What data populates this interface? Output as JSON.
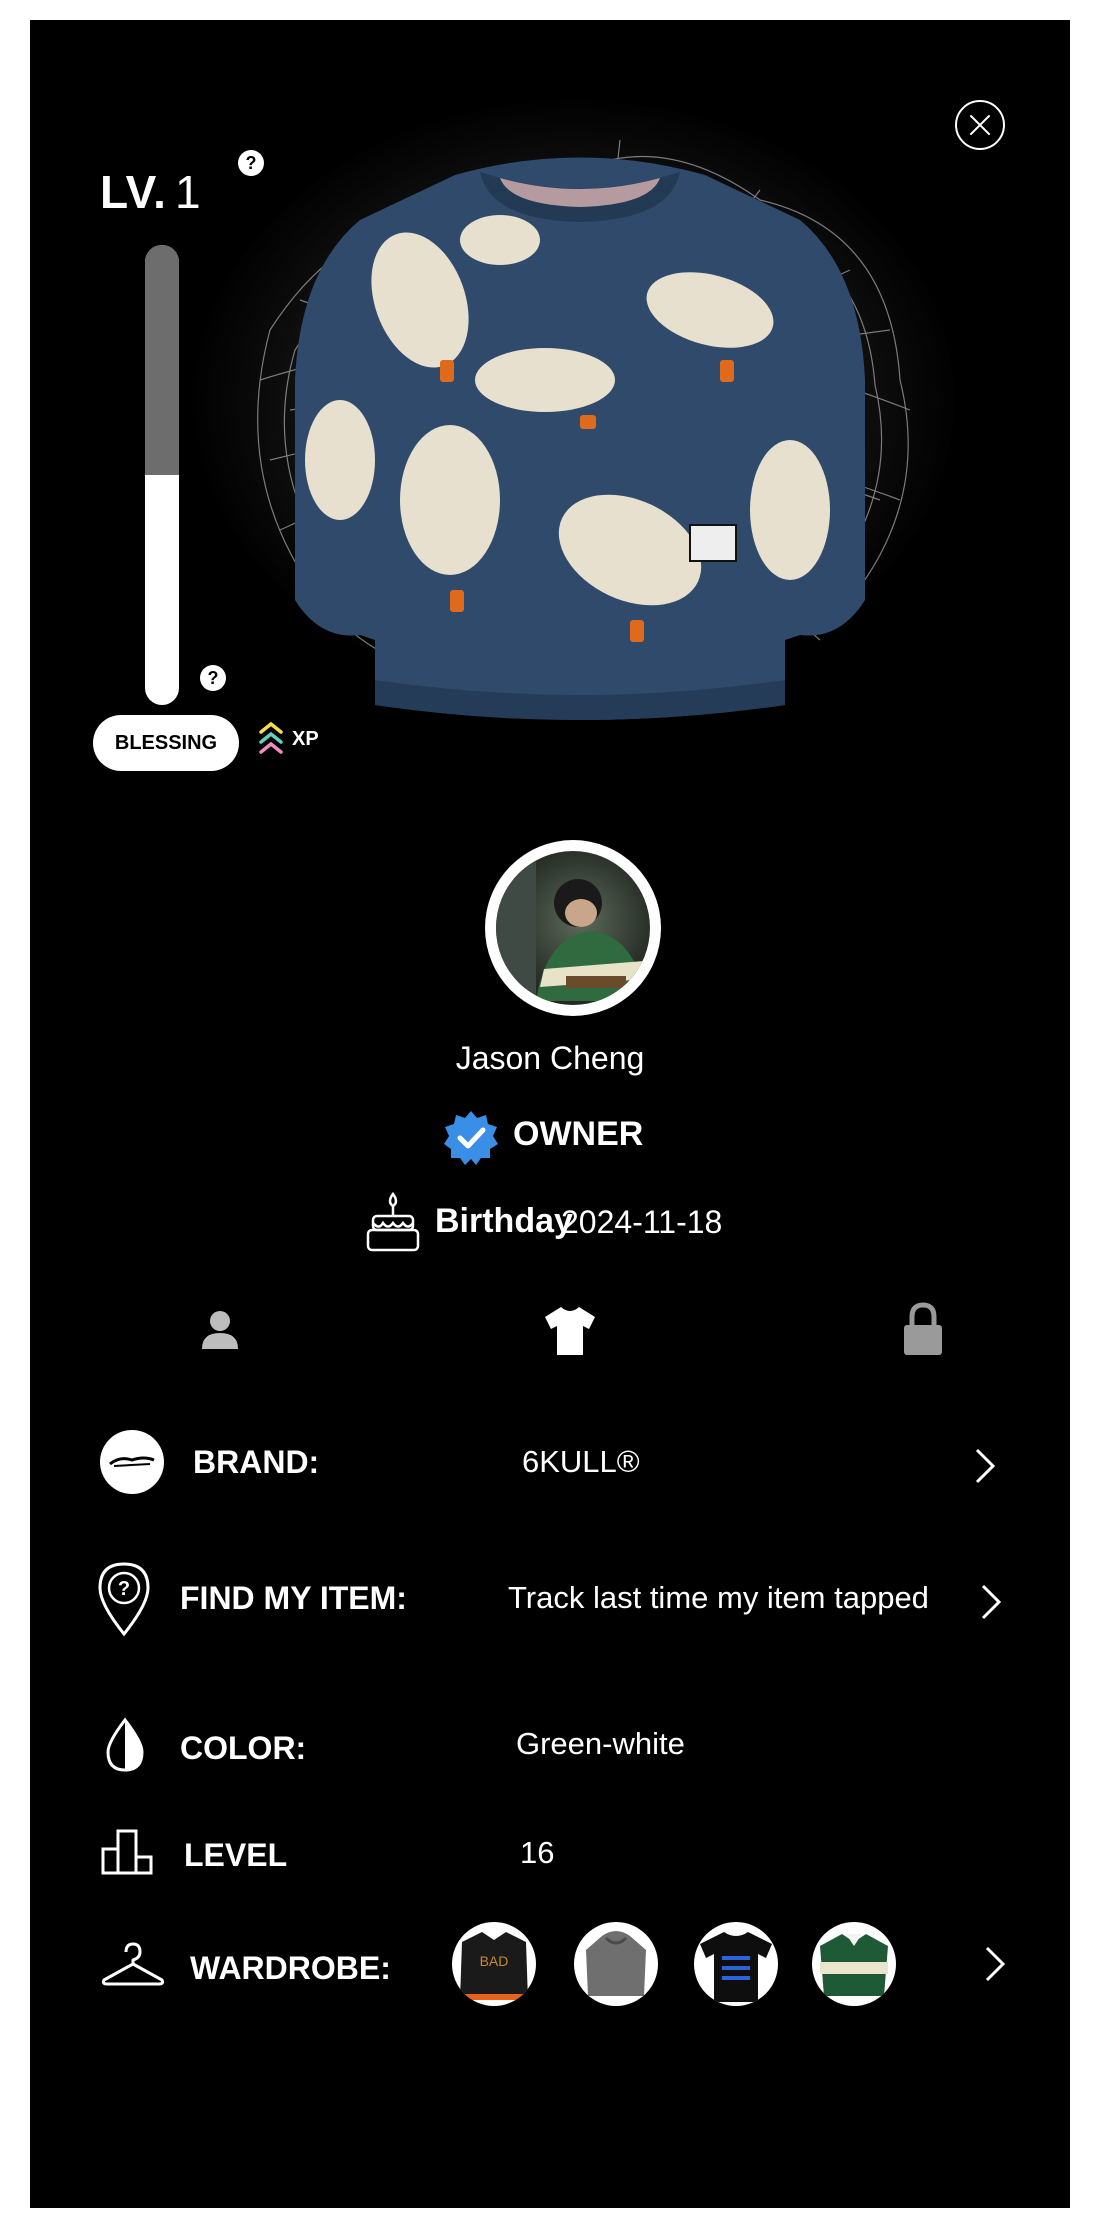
{
  "level": {
    "prefix": "LV.",
    "value": "1",
    "xp_progress_fraction": 0.5
  },
  "help_icon_text": "?",
  "blessing_label": "BLESSING",
  "xp_label": "XP",
  "hero": {
    "item_icon": "sweater-image"
  },
  "profile": {
    "name": "Jason Cheng",
    "role": "OWNER",
    "birthday_label": "Birthday",
    "birthday_value": "2024-11-18"
  },
  "tabs": [
    {
      "icon": "person-icon",
      "active": false
    },
    {
      "icon": "tshirt-icon",
      "active": true
    },
    {
      "icon": "lock-icon",
      "active": false
    }
  ],
  "details": {
    "brand_label": "BRAND:",
    "brand_value": "6KULL®",
    "find_label": "FIND MY ITEM:",
    "find_value": "Track last time my item tapped",
    "color_label": "COLOR:",
    "color_value": "Green-white",
    "level_label": "LEVEL",
    "level_value": "16",
    "wardrobe_label": "WARDROBE:",
    "wardrobe_items": [
      "black-jacket-thumb",
      "grey-hoodie-thumb",
      "black-tee-thumb",
      "green-polo-thumb"
    ]
  },
  "colors": {
    "background": "#000000",
    "xp_empty": "#6d6d6d",
    "verified_badge": "#3a8ee6",
    "sweater": "#2f4a6b"
  }
}
